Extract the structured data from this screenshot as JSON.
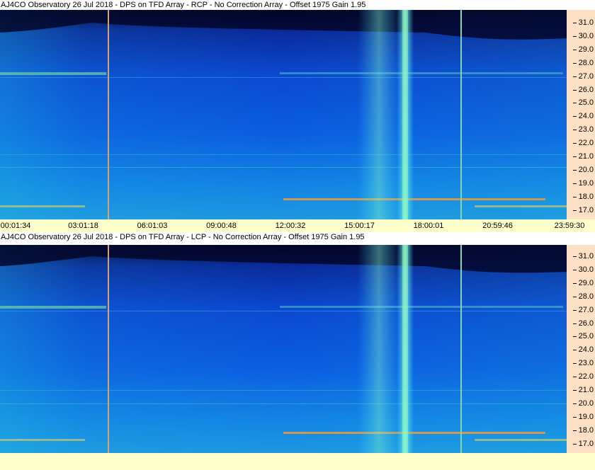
{
  "panels": [
    {
      "title": "AJ4CO Observatory 26 Jul 2018 - DPS on TFD Array  - RCP  -  No Correction Array  -  Offset 1975  Gain 1.95"
    },
    {
      "title": "AJ4CO Observatory 26 Jul 2018 - DPS on TFD Array  - LCP  -  No Correction Array  -  Offset 1975  Gain 1.95"
    }
  ],
  "yaxis_labels": [
    "31.0",
    "30.0",
    "29.0",
    "28.0",
    "27.0",
    "26.0",
    "25.0",
    "24.0",
    "23.0",
    "22.0",
    "21.0",
    "20.0",
    "19.0",
    "18.0",
    "17.0"
  ],
  "xaxis_labels": [
    "00:01:34",
    "03:01:18",
    "06:01:03",
    "09:00:48",
    "12:00:32",
    "15:00:17",
    "18:00:01",
    "20:59:46",
    "23:59:30"
  ],
  "colors": {
    "title_bg": "#ffffff",
    "axis_bg": "#fde0c4",
    "xaxis_bg": "#ffffcc",
    "spectrogram_dark": "#050a3a",
    "spectrogram_mid": "#0a4ed8",
    "spectrogram_bright": "#2fb8e8",
    "marker_line_1": "#d9a070",
    "marker_line_2": "#7fd6b0"
  }
}
